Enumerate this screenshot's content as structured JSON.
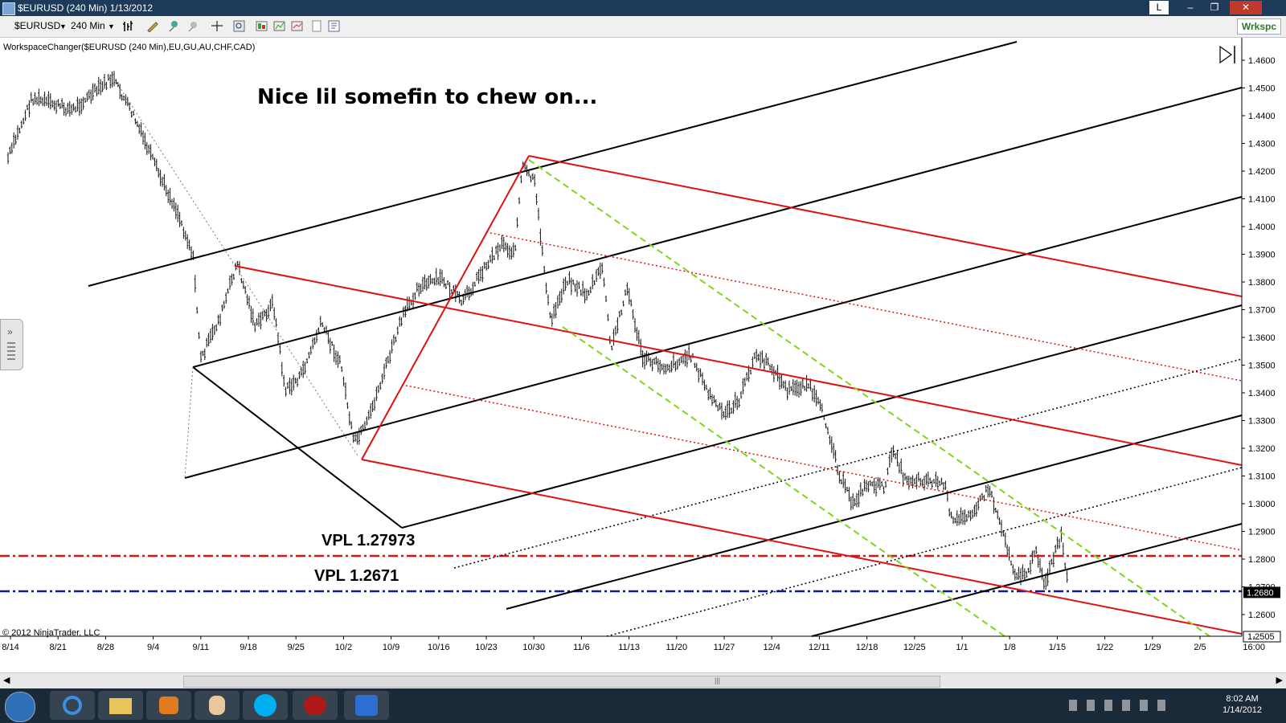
{
  "window": {
    "title": "$EURUSD (240 Min)  1/13/2012",
    "controls": [
      "L",
      "–",
      "❐",
      "✕"
    ]
  },
  "toolbar": {
    "instrument": "$EURUSD",
    "interval": "240 Min",
    "workspace": "Wrkspc"
  },
  "indicator_label": "WorkspaceChanger($EURUSD (240 Min),EU,GU,AU,CHF,CAD)",
  "annotations": {
    "headline": "Nice lil somefin to chew on...",
    "vpl1": "VPL 1.27973",
    "vpl2": "VPL 1.2671"
  },
  "copyright": "© 2012 NinjaTrader, LLC",
  "colors": {
    "red": "#e01010",
    "black": "#000000",
    "green": "#7fd61a",
    "vpl_red": "#e01010",
    "vpl_blue": "#0a1a99"
  },
  "price_axis": {
    "ticks": [
      "1.4600",
      "1.4500",
      "1.4400",
      "1.4300",
      "1.4200",
      "1.4100",
      "1.4000",
      "1.3900",
      "1.3800",
      "1.3700",
      "1.3600",
      "1.3500",
      "1.3400",
      "1.3300",
      "1.3200",
      "1.3100",
      "1.3000",
      "1.2900",
      "1.2800",
      "1.2700",
      "1.2600"
    ],
    "current": "1.2680",
    "last": "1.2505"
  },
  "time_axis": {
    "ticks": [
      "8/14",
      "8/21",
      "8/28",
      "9/4",
      "9/11",
      "9/18",
      "9/25",
      "10/2",
      "10/9",
      "10/16",
      "10/23",
      "10/30",
      "11/6",
      "11/13",
      "11/20",
      "11/27",
      "12/4",
      "12/11",
      "12/18",
      "12/25",
      "1/1",
      "1/8",
      "1/15",
      "1/22",
      "1/29",
      "2/5",
      "16:00"
    ]
  },
  "taskbar": {
    "time": "8:02 AM",
    "date": "1/14/2012"
  }
}
